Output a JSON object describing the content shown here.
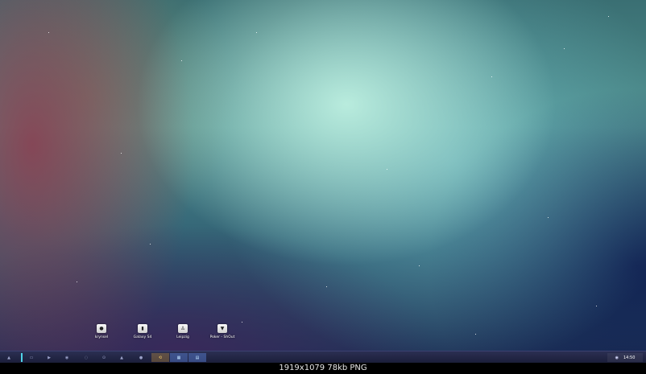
{
  "desktop": {
    "icons": [
      {
        "label": "krynsel",
        "icon": "user-icon"
      },
      {
        "label": "Galaxy S4",
        "icon": "phone-icon"
      },
      {
        "label": "Leipzig",
        "icon": "folder-user-icon"
      },
      {
        "label": "Poker - ShOut",
        "icon": "download-icon"
      }
    ]
  },
  "taskbar": {
    "start_glyph": "▲",
    "buttons": [
      "▭",
      "▶",
      "◉",
      "◌",
      "⊙",
      "▲",
      "●",
      "⟲",
      "▦",
      "▤"
    ],
    "clock": "14:50",
    "tray_glyph": "◉",
    "accent": "#4fd3e8"
  },
  "caption": "1919x1079 78kb PNG"
}
